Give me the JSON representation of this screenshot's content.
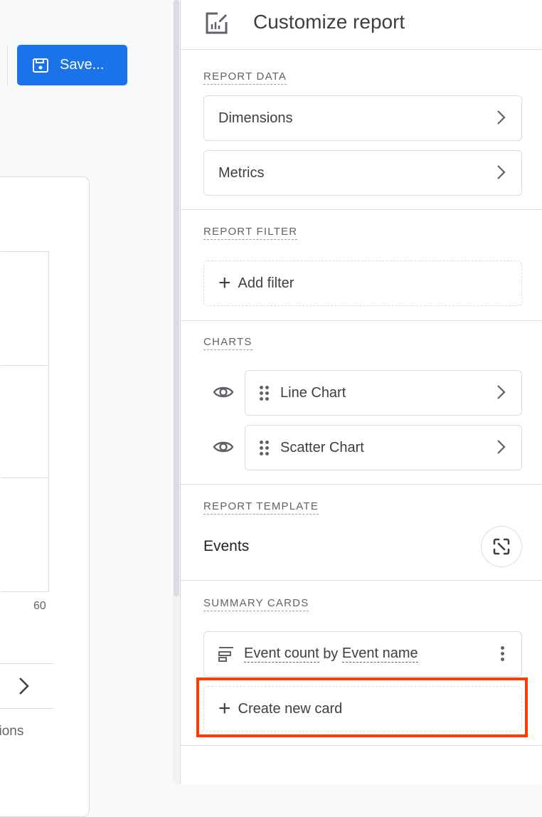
{
  "toolbar": {
    "save_label": "Save..."
  },
  "background_card": {
    "axis_text_fragment": "t",
    "axis_tick": "60",
    "footer_text_fragment": "sions"
  },
  "panel": {
    "title": "Customize report",
    "report_data": {
      "heading": "REPORT DATA",
      "items": [
        {
          "label": "Dimensions"
        },
        {
          "label": "Metrics"
        }
      ]
    },
    "report_filter": {
      "heading": "REPORT FILTER",
      "add_label": "Add filter"
    },
    "charts": {
      "heading": "CHARTS",
      "items": [
        {
          "label": "Line Chart",
          "visible": true
        },
        {
          "label": "Scatter Chart",
          "visible": true
        }
      ]
    },
    "report_template": {
      "heading": "REPORT TEMPLATE",
      "name": "Events"
    },
    "summary_cards": {
      "heading": "SUMMARY CARDS",
      "card": {
        "metric": "Event count",
        "by": "by",
        "dimension": "Event name"
      },
      "create_label": "Create new card"
    }
  },
  "colors": {
    "accent": "#1a73e8",
    "highlight": "#ff3d00"
  }
}
